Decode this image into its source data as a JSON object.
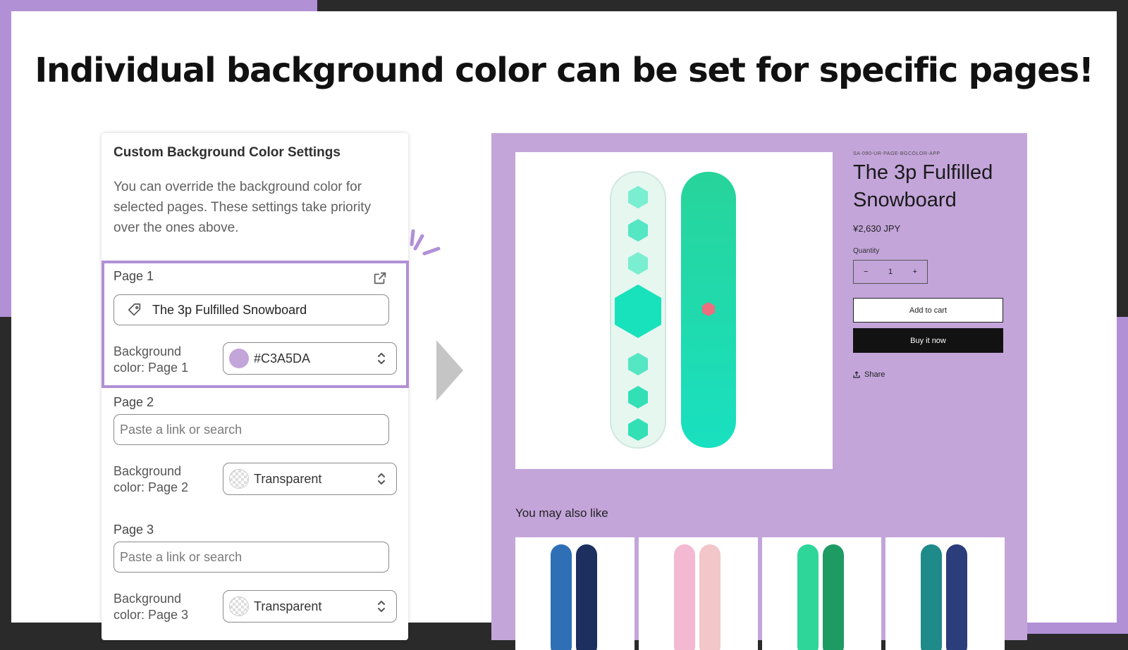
{
  "headline": "Individual background color can be set for specific pages!",
  "settings": {
    "title": "Custom Background Color Settings",
    "description": "You can override the background color for selected pages. These settings take priority over the ones above.",
    "pages": [
      {
        "label": "Page 1",
        "value": "The 3p Fulfilled Snowboard",
        "placeholder": "",
        "bg_label": "Background color: Page 1",
        "bg_value": "#C3A5DA",
        "bg_swatch": "#c3a5da"
      },
      {
        "label": "Page 2",
        "value": "",
        "placeholder": "Paste a link or search",
        "bg_label": "Background color: Page 2",
        "bg_value": "Transparent"
      },
      {
        "label": "Page 3",
        "value": "",
        "placeholder": "Paste a link or search",
        "bg_label": "Background color: Page 3",
        "bg_value": "Transparent"
      }
    ]
  },
  "store": {
    "background": "#c3a5da",
    "sku": "SA-090-UR-PAGE-BGCOLOR-APP",
    "title": "The 3p Fulfilled Snowboard",
    "price": "¥2,630 JPY",
    "quantity_label": "Quantity",
    "quantity_minus": "−",
    "quantity_value": "1",
    "quantity_plus": "+",
    "add_to_cart": "Add to cart",
    "buy_now": "Buy it now",
    "share": "Share",
    "also_like": "You may also like"
  },
  "colors": {
    "accent": "#b190d6",
    "dark": "#2a2a2a"
  }
}
